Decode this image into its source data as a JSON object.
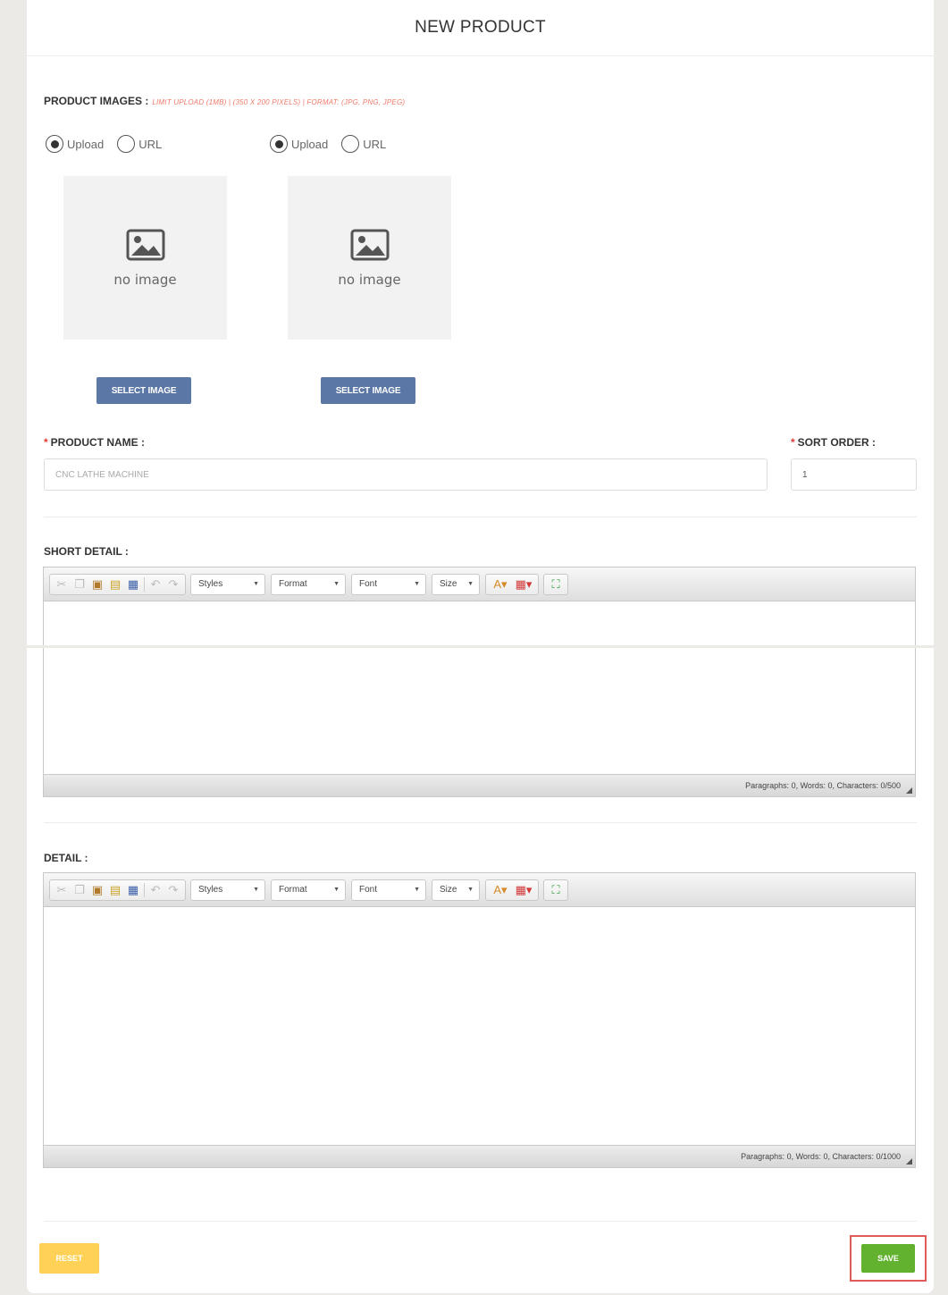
{
  "header": {
    "title": "NEW PRODUCT"
  },
  "images": {
    "label": "PRODUCT IMAGES :",
    "note": "LIMIT UPLOAD (1MB) | (350 X 200 PIXELS) | FORMAT: (JPG, PNG, JPEG)",
    "slots": [
      {
        "upload_label": "Upload",
        "url_label": "URL",
        "selected": "upload",
        "placeholder": "no image",
        "button_label": "SELECT IMAGE"
      },
      {
        "upload_label": "Upload",
        "url_label": "URL",
        "selected": "upload",
        "placeholder": "no image",
        "button_label": "SELECT IMAGE"
      }
    ]
  },
  "product_name": {
    "required_mark": "*",
    "label": "PRODUCT NAME :",
    "placeholder": "CNC LATHE MACHINE"
  },
  "sort_order": {
    "required_mark": "*",
    "label": "SORT ORDER :",
    "value": "1"
  },
  "toolbar": {
    "styles": "Styles",
    "format": "Format",
    "font": "Font",
    "size": "Size"
  },
  "short_detail": {
    "label": "SHORT DETAIL :",
    "status": "Paragraphs: 0, Words: 0, Characters: 0/500"
  },
  "detail": {
    "label": "DETAIL :",
    "status": "Paragraphs: 0, Words: 0, Characters: 0/1000"
  },
  "actions": {
    "reset_label": "RESET",
    "save_label": "SAVE"
  },
  "colors": {
    "select_button": "#5b77a5",
    "reset_button": "#ffd157",
    "save_button": "#62b22f",
    "note_text": "#ef7a6a",
    "highlight": "#e05a5a"
  }
}
